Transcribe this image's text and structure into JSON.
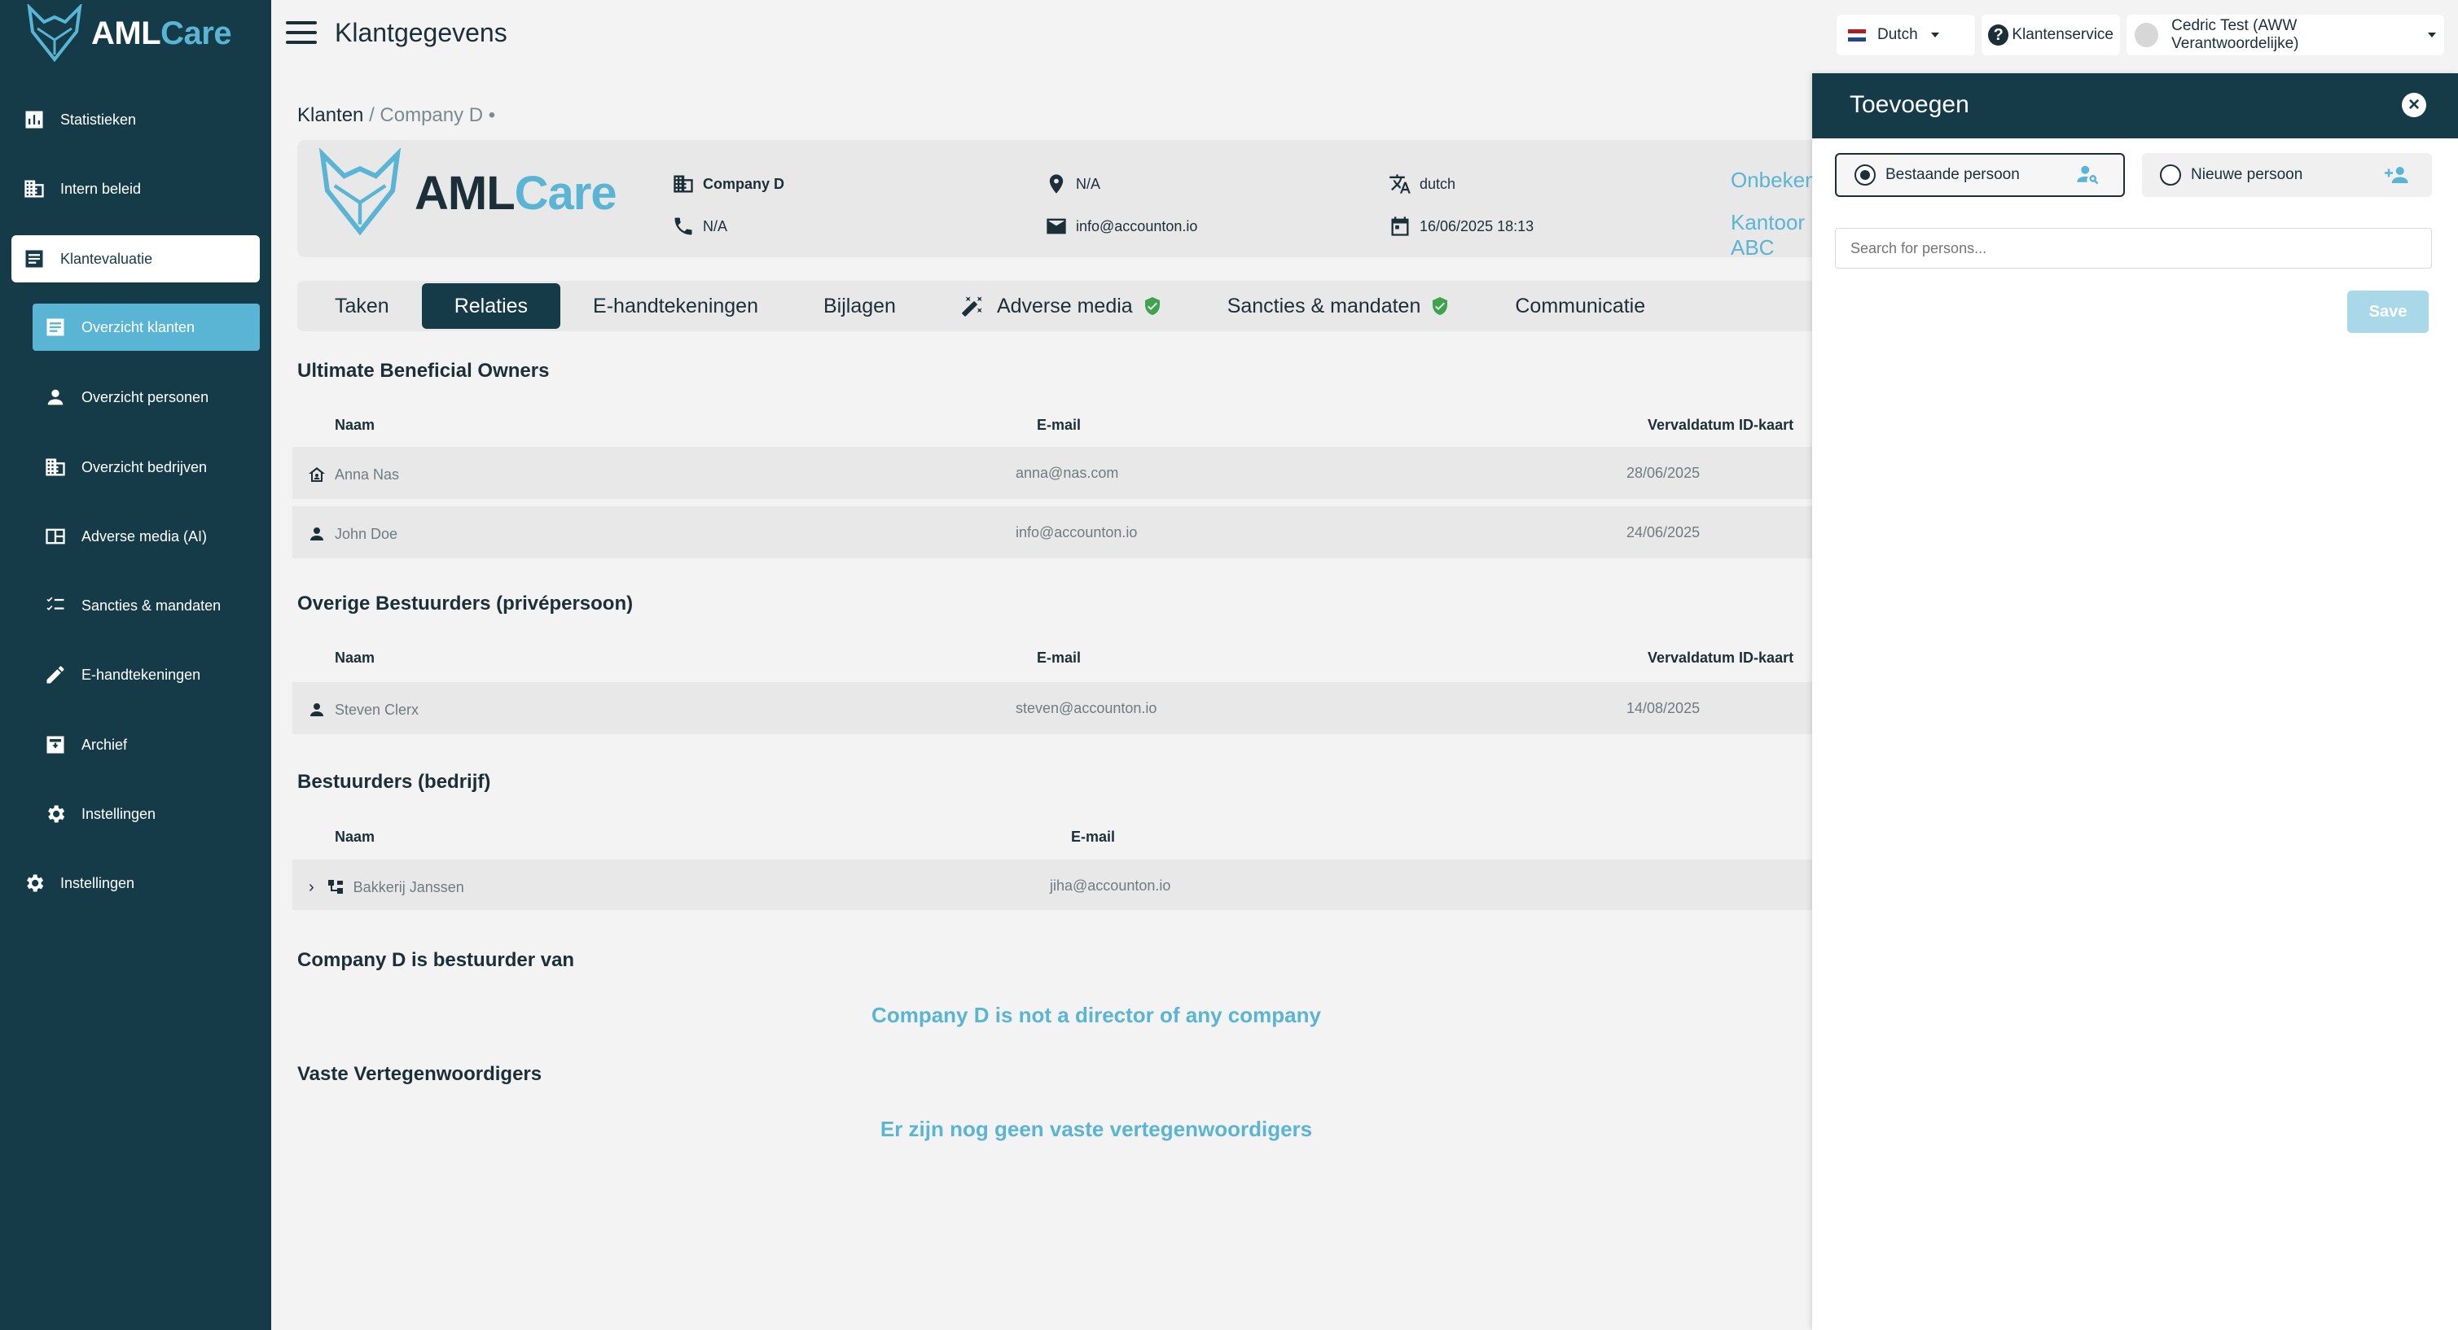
{
  "app": {
    "logo_aml": "AML",
    "logo_care": "Care",
    "page_title": "Klantgegevens"
  },
  "topbar": {
    "language": "Dutch",
    "support": "Klantenservice",
    "user": "Cedric Test (AWW Verantwoordelijke)"
  },
  "sidebar": {
    "items": [
      {
        "label": "Statistieken",
        "icon": "bar-chart-icon"
      },
      {
        "label": "Intern beleid",
        "icon": "building-icon"
      },
      {
        "label": "Klantevaluatie",
        "icon": "document-icon"
      },
      {
        "label": "Overzicht klanten",
        "icon": "list-icon"
      },
      {
        "label": "Overzicht personen",
        "icon": "person-icon"
      },
      {
        "label": "Overzicht bedrijven",
        "icon": "building-icon"
      },
      {
        "label": "Adverse media (AI)",
        "icon": "newspaper-icon"
      },
      {
        "label": "Sancties & mandaten",
        "icon": "checklist-icon"
      },
      {
        "label": "E-handtekeningen",
        "icon": "pen-icon"
      },
      {
        "label": "Archief",
        "icon": "archive-icon"
      },
      {
        "label": "Instellingen",
        "icon": "gear-icon"
      },
      {
        "label": "Instellingen",
        "icon": "gear-icon"
      }
    ]
  },
  "breadcrumb": {
    "root": "Klanten",
    "current": "/ Company D •"
  },
  "client": {
    "name": "Company D",
    "address": "N/A",
    "language": "dutch",
    "phone": "N/A",
    "email": "info@accounton.io",
    "date": "16/06/2025 18:13",
    "status": "Onbekend",
    "office": "Kantoor ABC"
  },
  "tabs": [
    {
      "label": "Taken"
    },
    {
      "label": "Relaties"
    },
    {
      "label": "E-handtekeningen"
    },
    {
      "label": "Bijlagen"
    },
    {
      "label": "Adverse media"
    },
    {
      "label": "Sancties & mandaten"
    },
    {
      "label": "Communicatie"
    }
  ],
  "ubo": {
    "title": "Ultimate Beneficial Owners",
    "columns": [
      "Naam",
      "E-mail",
      "Vervaldatum ID-kaart"
    ],
    "rows": [
      {
        "name": "Anna Nas",
        "email": "anna@nas.com",
        "expiry": "28/06/2025"
      },
      {
        "name": "John Doe",
        "email": "info@accounton.io",
        "expiry": "24/06/2025"
      }
    ]
  },
  "other_directors": {
    "title": "Overige Bestuurders (privépersoon)",
    "columns": [
      "Naam",
      "E-mail",
      "Vervaldatum ID-kaart"
    ],
    "rows": [
      {
        "name": "Steven Clerx",
        "email": "steven@accounton.io",
        "expiry": "14/08/2025"
      }
    ]
  },
  "company_directors": {
    "title": "Bestuurders (bedrijf)",
    "columns": [
      "Naam",
      "E-mail"
    ],
    "rows": [
      {
        "name": "Bakkerij Janssen",
        "email": "jiha@accounton.io"
      }
    ]
  },
  "director_of": {
    "title": "Company D is bestuurder van",
    "empty": "Company D is not a director of any company"
  },
  "representatives": {
    "title": "Vaste Vertegenwoordigers",
    "empty": "Er zijn nog geen vaste vertegenwoordigers"
  },
  "drawer": {
    "title": "Toevoegen",
    "option_existing": "Bestaande persoon",
    "option_new": "Nieuwe persoon",
    "search_placeholder": "Search for persons...",
    "save_label": "Save"
  },
  "colors": {
    "sidebar": "#143b47",
    "accent": "#5ab4d3",
    "shield": "#3fa34d"
  }
}
